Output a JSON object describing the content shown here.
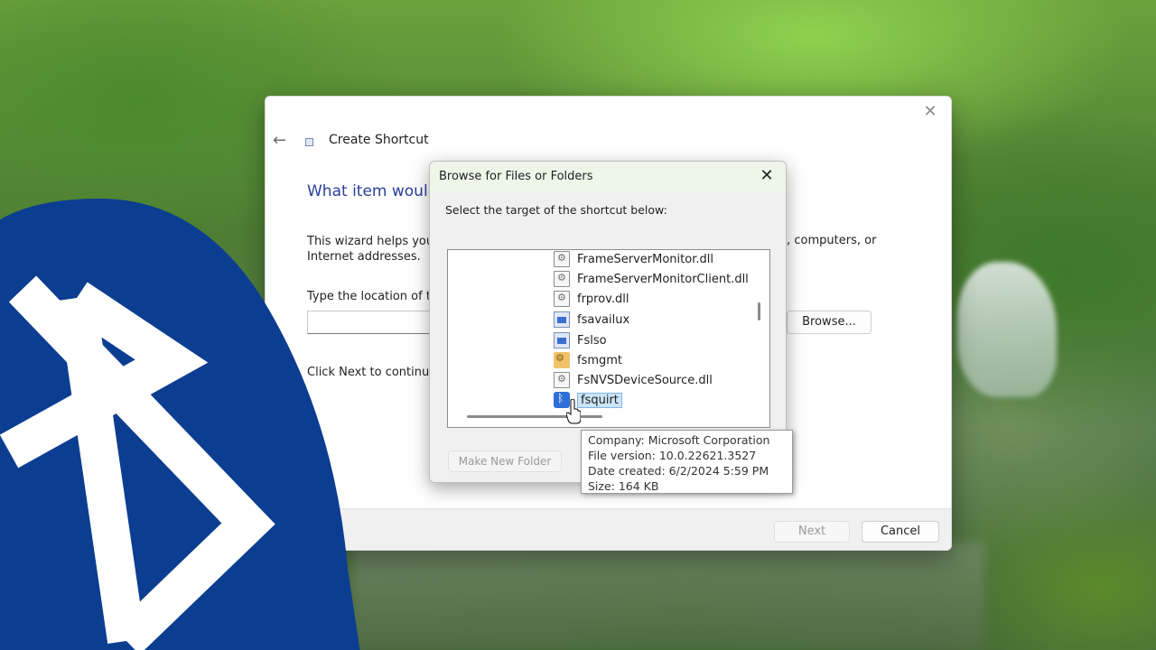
{
  "wizard": {
    "title": "Create Shortcut",
    "close_glyph": "✕",
    "back_glyph": "←",
    "heading": "What item woul",
    "description_line1": "This wizard helps you",
    "description_right": "ers, computers, or",
    "description_line2": "Internet addresses.",
    "location_label": "Type the location of t",
    "location_value": "",
    "browse_label": "Browse...",
    "next_prompt": "Click Next to continu",
    "next_label": "Next",
    "cancel_label": "Cancel"
  },
  "browse_dialog": {
    "title": "Browse for Files or Folders",
    "close_glyph": "✕",
    "prompt": "Select the target of the shortcut below:",
    "items": [
      {
        "label": "FrameServerMonitor.dll",
        "icon": "dll-file-icon"
      },
      {
        "label": "FrameServerMonitorClient.dll",
        "icon": "dll-file-icon"
      },
      {
        "label": "frprov.dll",
        "icon": "dll-file-icon"
      },
      {
        "label": "fsavailux",
        "icon": "exe-file-icon"
      },
      {
        "label": "Fslso",
        "icon": "exe-file-icon"
      },
      {
        "label": "fsmgmt",
        "icon": "management-console-icon"
      },
      {
        "label": "FsNVSDeviceSource.dll",
        "icon": "dll-file-icon"
      },
      {
        "label": "fsquirt",
        "icon": "bluetooth-file-icon",
        "selected": true
      }
    ],
    "new_folder_label": "Make New Folder"
  },
  "tooltip": {
    "company": "Company: Microsoft Corporation",
    "file_version": "File version: 10.0.22621.3527",
    "date_created": "Date created: 6/2/2024 5:59 PM",
    "size": "Size: 164 KB"
  },
  "colors": {
    "heading_blue": "#2b3e99",
    "bluetooth_blue": "#0b3d91",
    "selection": "#cce4f7"
  }
}
